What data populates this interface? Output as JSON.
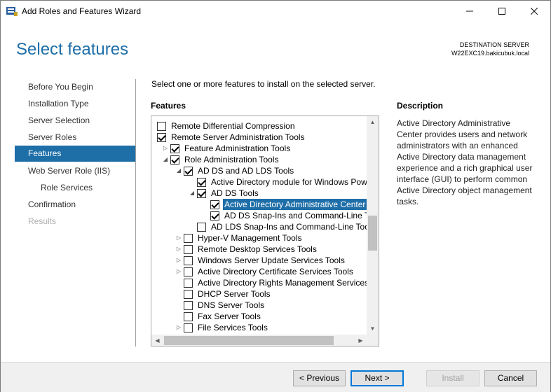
{
  "window": {
    "title": "Add Roles and Features Wizard"
  },
  "header": {
    "title": "Select features",
    "destination_label": "DESTINATION SERVER",
    "destination_server": "W22EXC19.bakicubuk.local"
  },
  "nav": {
    "items": [
      {
        "label": "Before You Begin",
        "state": "normal"
      },
      {
        "label": "Installation Type",
        "state": "normal"
      },
      {
        "label": "Server Selection",
        "state": "normal"
      },
      {
        "label": "Server Roles",
        "state": "normal"
      },
      {
        "label": "Features",
        "state": "active"
      },
      {
        "label": "Web Server Role (IIS)",
        "state": "normal"
      },
      {
        "label": "Role Services",
        "state": "sub"
      },
      {
        "label": "Confirmation",
        "state": "normal"
      },
      {
        "label": "Results",
        "state": "disabled"
      }
    ]
  },
  "main": {
    "instruction": "Select one or more features to install on the selected server.",
    "features_heading": "Features",
    "description_heading": "Description",
    "description_text": "Active Directory Administrative Center provides users and network administrators with an enhanced Active Directory data management experience and a rich graphical user interface (GUI) to perform common Active Directory object management tasks."
  },
  "tree": [
    {
      "label": "Remote Differential Compression",
      "checked": false,
      "level": 0,
      "expander": ""
    },
    {
      "label": "Remote Server Administration Tools",
      "checked": true,
      "level": 0,
      "expander": ""
    },
    {
      "label": "Feature Administration Tools",
      "checked": true,
      "level": 1,
      "expander": "▷"
    },
    {
      "label": "Role Administration Tools",
      "checked": true,
      "level": 1,
      "expander": "◢"
    },
    {
      "label": "AD DS and AD LDS Tools",
      "checked": true,
      "level": 2,
      "expander": "◢"
    },
    {
      "label": "Active Directory module for Windows PowerShell",
      "checked": true,
      "level": 3,
      "expander": ""
    },
    {
      "label": "AD DS Tools",
      "checked": true,
      "level": 3,
      "expander": "◢"
    },
    {
      "label": "Active Directory Administrative Center",
      "checked": true,
      "level": 4,
      "expander": "",
      "selected": true
    },
    {
      "label": "AD DS Snap-Ins and Command-Line Tools",
      "checked": true,
      "level": 4,
      "expander": ""
    },
    {
      "label": "AD LDS Snap-Ins and Command-Line Tools",
      "checked": false,
      "level": 3,
      "expander": ""
    },
    {
      "label": "Hyper-V Management Tools",
      "checked": false,
      "level": 2,
      "expander": "▷"
    },
    {
      "label": "Remote Desktop Services Tools",
      "checked": false,
      "level": 2,
      "expander": "▷"
    },
    {
      "label": "Windows Server Update Services Tools",
      "checked": false,
      "level": 2,
      "expander": "▷"
    },
    {
      "label": "Active Directory Certificate Services Tools",
      "checked": false,
      "level": 2,
      "expander": "▷"
    },
    {
      "label": "Active Directory Rights Management Services Tools",
      "checked": false,
      "level": 2,
      "expander": ""
    },
    {
      "label": "DHCP Server Tools",
      "checked": false,
      "level": 2,
      "expander": ""
    },
    {
      "label": "DNS Server Tools",
      "checked": false,
      "level": 2,
      "expander": ""
    },
    {
      "label": "Fax Server Tools",
      "checked": false,
      "level": 2,
      "expander": ""
    },
    {
      "label": "File Services Tools",
      "checked": false,
      "level": 2,
      "expander": "▷"
    }
  ],
  "footer": {
    "previous_label": "< Previous",
    "next_label": "Next >",
    "install_label": "Install",
    "cancel_label": "Cancel"
  },
  "colors": {
    "accent": "#1e6ea8",
    "title": "#1e6ea8"
  }
}
